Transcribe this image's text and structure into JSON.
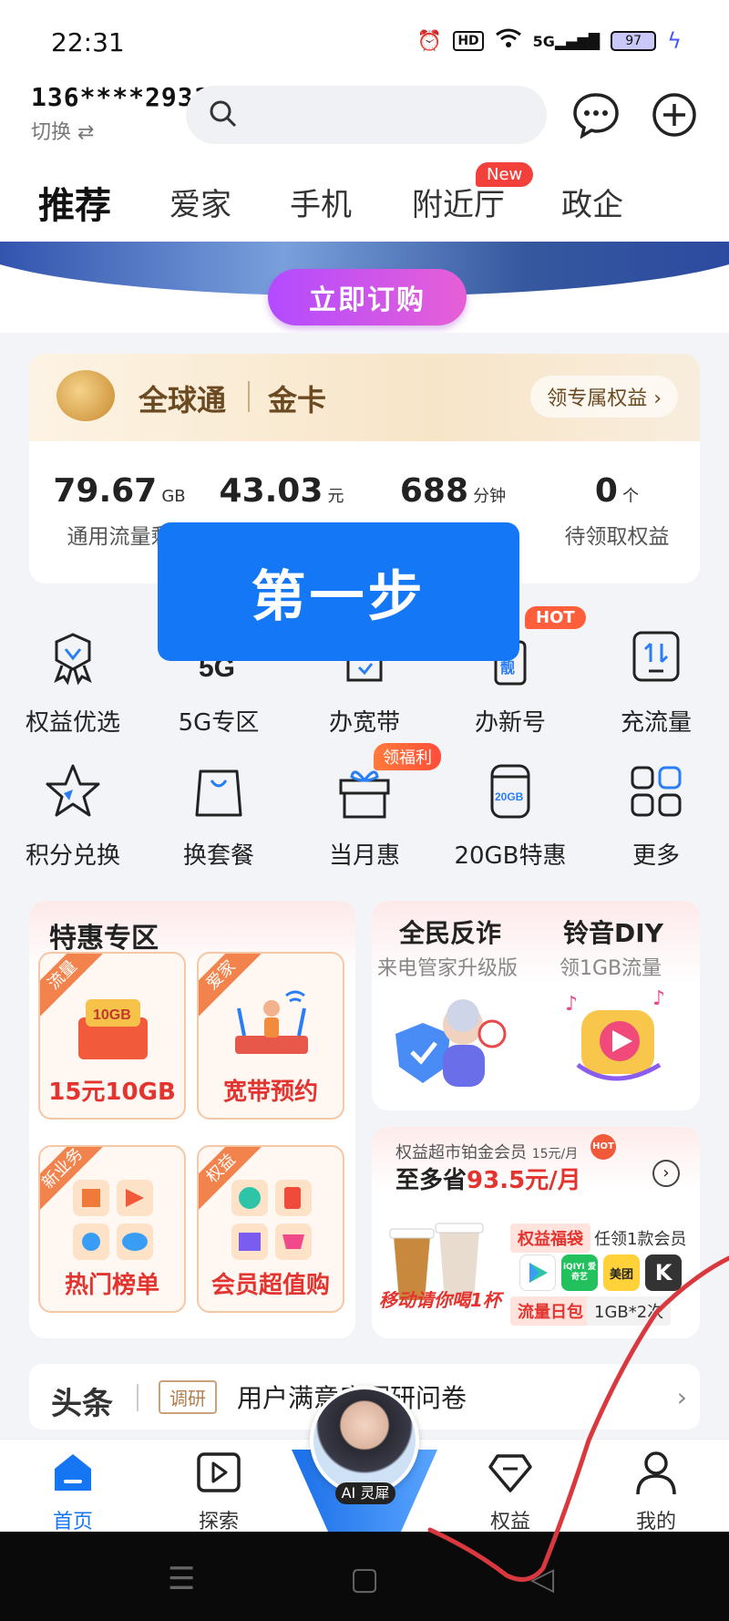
{
  "status_bar": {
    "time": "22:31",
    "hd": "HD",
    "network": "5G",
    "battery": "97"
  },
  "account": {
    "number": "136****2931",
    "switch_label": "切换 ⇄"
  },
  "search": {
    "placeholder": ""
  },
  "tabs": [
    {
      "label": "推荐",
      "active": true
    },
    {
      "label": "爱家"
    },
    {
      "label": "手机"
    },
    {
      "label": "附近厅",
      "badge": "New"
    },
    {
      "label": "政企"
    }
  ],
  "banner": {
    "button_label": "立即订购"
  },
  "gold_card": {
    "brand": "全球通",
    "tier": "金卡",
    "perk_button": "领专属权益 ›",
    "stats": [
      {
        "value": "79.67",
        "unit": "GB",
        "label": "通用流量剩"
      },
      {
        "value": "43.03",
        "unit": "元",
        "label": ""
      },
      {
        "value": "688",
        "unit": "分钟",
        "label": ""
      },
      {
        "value": "0",
        "unit": "个",
        "label": "待领取权益"
      }
    ]
  },
  "overlay": {
    "text": "第一步"
  },
  "grid_row1": [
    {
      "label": "权益优选",
      "icon": "ribbon-badge-icon"
    },
    {
      "label": "5G专区",
      "icon": "5g-icon"
    },
    {
      "label": "办宽带",
      "icon": "broadband-icon"
    },
    {
      "label": "办新号",
      "icon": "new-number-icon",
      "badge": "HOT"
    },
    {
      "label": "充流量",
      "icon": "data-recharge-icon"
    }
  ],
  "grid_row2": [
    {
      "label": "积分兑换",
      "icon": "star-icon"
    },
    {
      "label": "换套餐",
      "icon": "bag-icon"
    },
    {
      "label": "当月惠",
      "icon": "gift-icon",
      "badge": "领福利"
    },
    {
      "label": "20GB特惠",
      "icon": "20gb-can-icon",
      "inner": "20GB"
    },
    {
      "label": "更多",
      "icon": "grid-more-icon"
    }
  ],
  "promo_left": {
    "title": "特惠专区",
    "tiles": [
      {
        "corner": "流量",
        "label": "15元10GB",
        "art_text": "10GB"
      },
      {
        "corner": "爱家",
        "label": "宽带预约"
      },
      {
        "corner": "新业务",
        "label": "热门榜单"
      },
      {
        "corner": "权益",
        "label": "会员超值购"
      }
    ]
  },
  "promo_right_top": [
    {
      "title": "全民反诈",
      "subtitle": "来电管家升级版"
    },
    {
      "title": "铃音DIY",
      "subtitle": "领1GB流量"
    }
  ],
  "promo_right_bottom": {
    "caption": "权益超市铂金会员",
    "caption_price": "15元/月",
    "headline_prefix": "至多省",
    "headline_amount": "93.5元/月",
    "hot": "HOT",
    "chip1": "权益福袋",
    "chip1_text": "任领1款会员",
    "chip2": "流量日包",
    "chip2_text": "1GB*2次",
    "drink_text": "移动请你喝1杯",
    "apps": [
      "iQIYI 爱奇艺",
      "美团",
      "K"
    ]
  },
  "headline": {
    "label": "头条",
    "tag": "调研",
    "text": "用户满意度调研问卷"
  },
  "bottom_nav": [
    {
      "label": "首页",
      "active": true
    },
    {
      "label": "探索"
    },
    {
      "label": "权益"
    },
    {
      "label": "我的"
    }
  ],
  "ai_assistant": {
    "label": "AI 灵犀"
  },
  "colors": {
    "accent": "#1476f2",
    "red": "#e3342f",
    "gold_text": "#6b4a22",
    "overlay": "#1478f6"
  }
}
